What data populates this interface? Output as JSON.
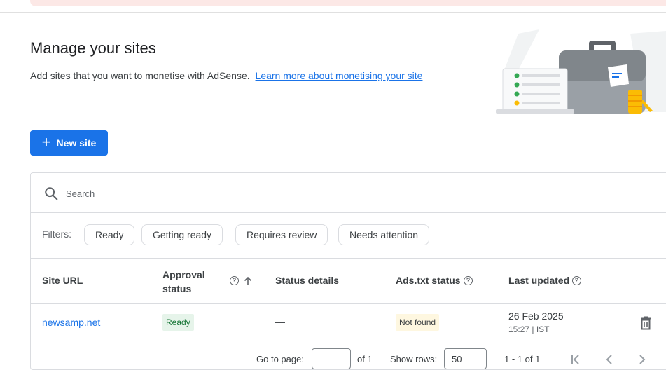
{
  "page": {
    "title": "Manage your sites",
    "description": "Add sites that you want to monetise with AdSense.",
    "learn_more_link": "Learn more about monetising your site"
  },
  "actions": {
    "new_site_label": "New site"
  },
  "search": {
    "placeholder": "Search"
  },
  "filters": {
    "label": "Filters:",
    "chips": [
      "Ready",
      "Getting ready",
      "Requires review",
      "Needs attention"
    ]
  },
  "table": {
    "columns": {
      "site_url": "Site URL",
      "approval_status_line1": "Approval",
      "approval_status_line2": "status",
      "status_details": "Status details",
      "ads_txt_status": "Ads.txt status",
      "last_updated": "Last updated"
    },
    "rows": [
      {
        "site_url": "newsamp.net",
        "approval_status": "Ready",
        "status_details": "—",
        "ads_txt_status": "Not found",
        "last_updated_date": "26 Feb 2025",
        "last_updated_time": "15:27 | IST"
      }
    ]
  },
  "pagination": {
    "go_to_page_label": "Go to page:",
    "of_pages": "of 1",
    "show_rows_label": "Show rows:",
    "rows_per_page": "50",
    "range": "1 - 1 of 1"
  },
  "colors": {
    "primary": "#1a73e8",
    "ready_badge_bg": "#e6f4ea",
    "ready_badge_text": "#137333",
    "not_found_badge_bg": "#fef7e0",
    "banner_bg": "#fce8e6"
  }
}
